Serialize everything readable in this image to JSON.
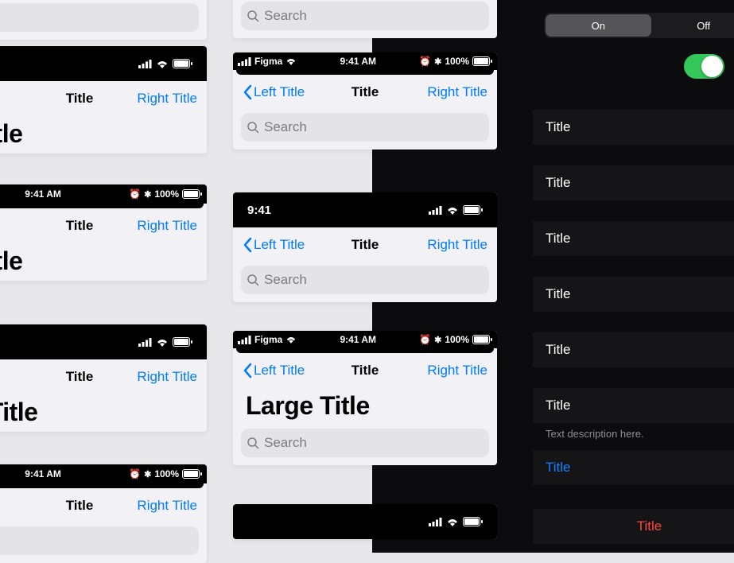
{
  "colors": {
    "accent": "#007aff",
    "accent_dark": "#0a84ff",
    "danger": "#ff453a",
    "toggle_on": "#34c759"
  },
  "status": {
    "time": "9:41 AM",
    "time_short": "9:41",
    "battery": "100%",
    "carrier": "Figma"
  },
  "nav": {
    "title": "Title",
    "left": "Left Title",
    "right": "Right Title",
    "large": "Large Title",
    "large_cut": "e Title",
    "large_cut2": "ge Title"
  },
  "search": {
    "placeholder": "Search",
    "placeholder_cut": "arch"
  },
  "seg": {
    "on": "On",
    "off": "Off"
  },
  "rows": {
    "items": [
      {
        "label": "Title"
      },
      {
        "label": "Title"
      },
      {
        "label": "Title"
      },
      {
        "label": "Title"
      },
      {
        "label": "Title"
      },
      {
        "label": "Title"
      }
    ],
    "desc": "Text description here.",
    "link": "Title",
    "danger": "Title"
  }
}
